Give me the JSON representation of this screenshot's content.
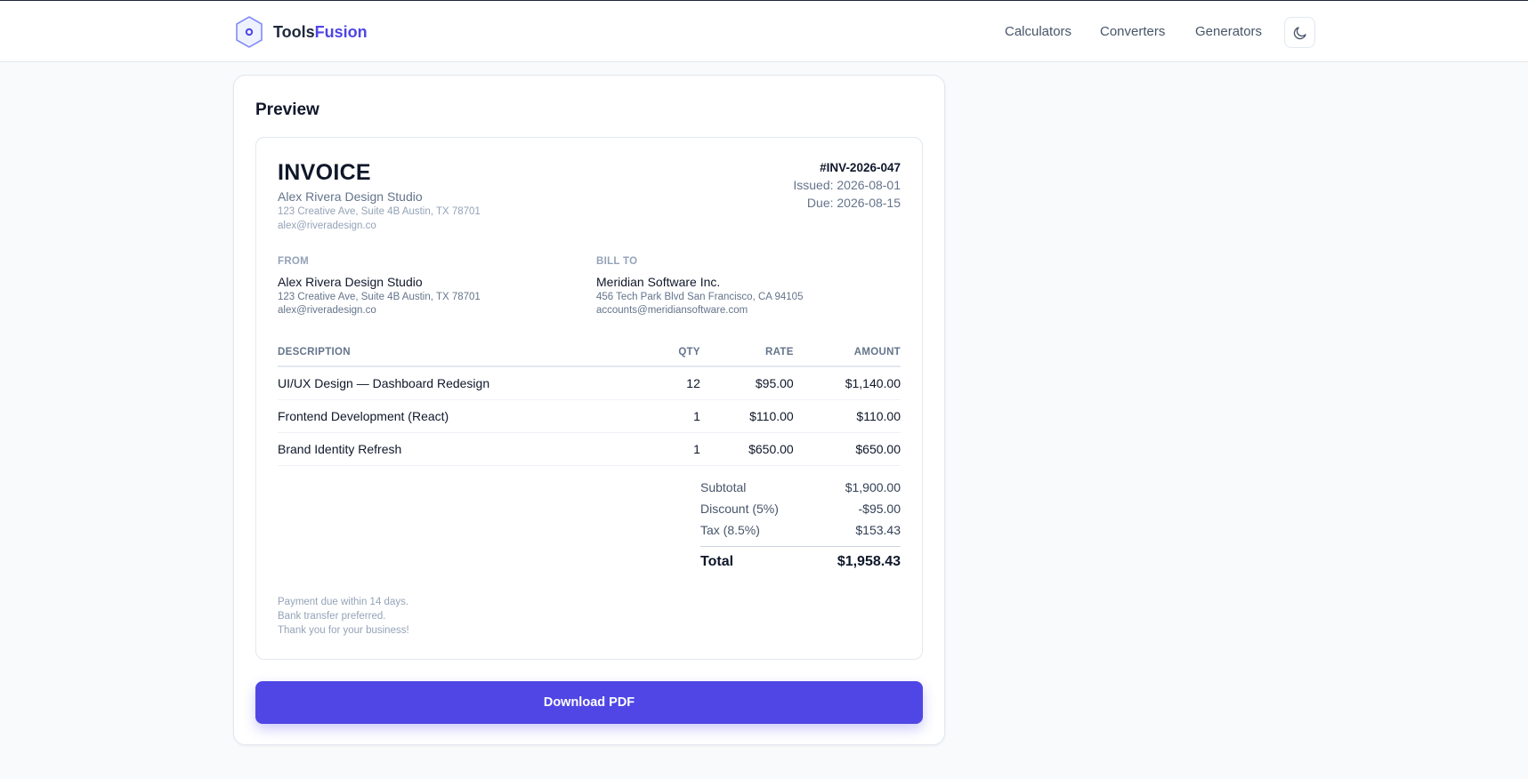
{
  "brand": {
    "name_prefix": "Tools",
    "name_accent": "Fusion",
    "accent_color": "#4f46e5"
  },
  "nav": {
    "items": [
      "Calculators",
      "Converters",
      "Generators"
    ],
    "theme_toggle_icon": "moon-icon"
  },
  "preview": {
    "title": "Preview",
    "invoice": {
      "heading": "INVOICE",
      "company": "Alex Rivera Design Studio",
      "company_address": "123 Creative Ave, Suite 4B Austin, TX 78701",
      "company_email": "alex@riveradesign.co",
      "number": "#INV-2026-047",
      "issued": "Issued: 2026-08-01",
      "due": "Due: 2026-08-15",
      "from": {
        "label": "FROM",
        "name": "Alex Rivera Design Studio",
        "address": "123 Creative Ave, Suite 4B Austin, TX 78701",
        "email": "alex@riveradesign.co"
      },
      "bill_to": {
        "label": "BILL TO",
        "name": "Meridian Software Inc.",
        "address": "456 Tech Park Blvd San Francisco, CA 94105",
        "email": "accounts@meridiansoftware.com"
      },
      "columns": {
        "description": "DESCRIPTION",
        "qty": "QTY",
        "rate": "RATE",
        "amount": "AMOUNT"
      },
      "items": [
        {
          "description": "UI/UX Design — Dashboard Redesign",
          "qty": "12",
          "rate": "$95.00",
          "amount": "$1,140.00"
        },
        {
          "description": "Frontend Development (React)",
          "qty": "1",
          "rate": "$110.00",
          "amount": "$110.00"
        },
        {
          "description": "Brand Identity Refresh",
          "qty": "1",
          "rate": "$650.00",
          "amount": "$650.00"
        }
      ],
      "totals": {
        "subtotal_label": "Subtotal",
        "subtotal": "$1,900.00",
        "discount_label": "Discount (5%)",
        "discount": "-$95.00",
        "tax_label": "Tax (8.5%)",
        "tax": "$153.43",
        "total_label": "Total",
        "total": "$1,958.43"
      },
      "notes": [
        "Payment due within 14 days.",
        "Bank transfer preferred.",
        "Thank you for your business!"
      ]
    },
    "download_label": "Download PDF"
  }
}
